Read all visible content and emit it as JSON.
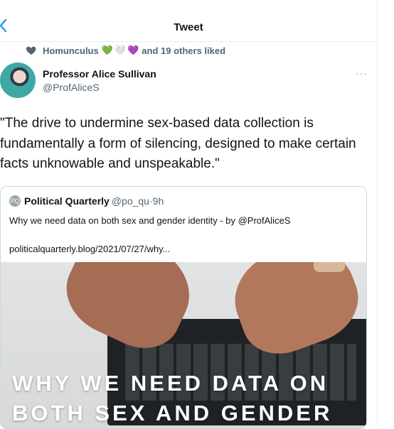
{
  "header": {
    "title": "Tweet",
    "back_icon": "chevron-left-icon"
  },
  "social_context": {
    "name": "Homunculus",
    "emoji": [
      "💚",
      "🤍",
      "💜"
    ],
    "others": "and 19 others liked"
  },
  "tweet": {
    "author_name": "Professor Alice Sullivan",
    "author_handle": "@ProfAliceS",
    "more_label": "···",
    "text": "\"The drive to undermine sex-based data collection is fundamentally a form of silencing, designed to make certain facts unknowable and unspeakable.\""
  },
  "quoted": {
    "logo_text": "PQ",
    "name": "Political Quarterly",
    "handle": "@po_qu",
    "separator": "·",
    "time": "9h",
    "text": "Why we need data on both sex and gender identity - by @ProfAliceS",
    "link": "politicalquarterly.blog/2021/07/27/why...",
    "image_title_line1": "WHY WE NEED DATA ON",
    "image_title_line2": "BOTH SEX AND GENDER"
  },
  "colors": {
    "accent": "#1d9bf0",
    "secondary_text": "#536471",
    "border": "#cfd9de"
  }
}
